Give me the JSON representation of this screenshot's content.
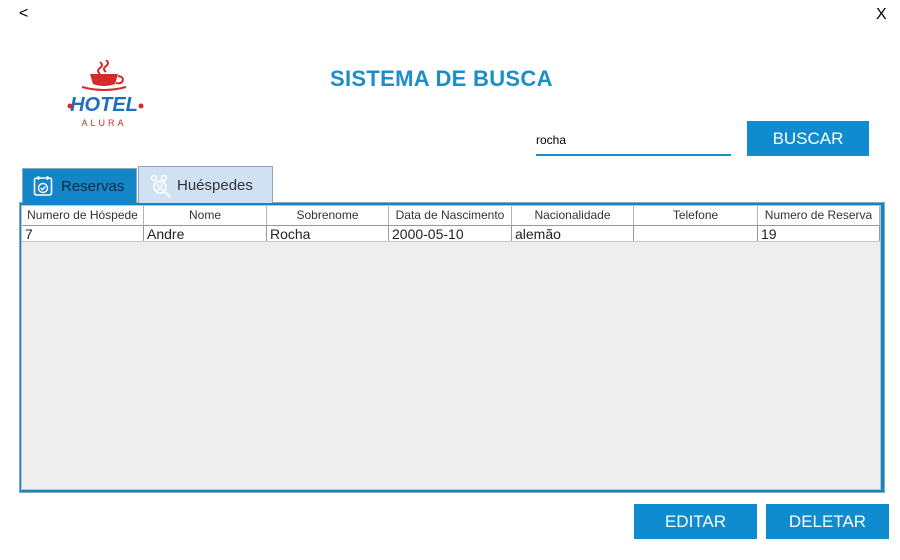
{
  "window": {
    "back_label": "<",
    "close_label": "X"
  },
  "logo": {
    "text": "HOTEL",
    "subtext": "ALURA"
  },
  "header": {
    "title": "SISTEMA DE BUSCA"
  },
  "search": {
    "value": "rocha",
    "button_label": "BUSCAR"
  },
  "tabs": [
    {
      "label": "Reservas",
      "icon": "calendar-check-icon",
      "active": false
    },
    {
      "label": "Huéspedes",
      "icon": "users-search-icon",
      "active": true
    }
  ],
  "table": {
    "columns": [
      "Numero de Hóspede",
      "Nome",
      "Sobrenome",
      "Data de Nascimento",
      "Nacionalidade",
      "Telefone",
      "Numero de Reserva"
    ],
    "rows": [
      [
        "7",
        "Andre",
        "Rocha",
        "2000-05-10",
        "alemão",
        "",
        "19"
      ]
    ]
  },
  "actions": {
    "edit_label": "EDITAR",
    "delete_label": "DELETAR"
  },
  "colors": {
    "accent": "#0f8ccf",
    "title": "#1b8ec9",
    "logo_red": "#d42a2a",
    "logo_blue": "#1f6fc0"
  }
}
